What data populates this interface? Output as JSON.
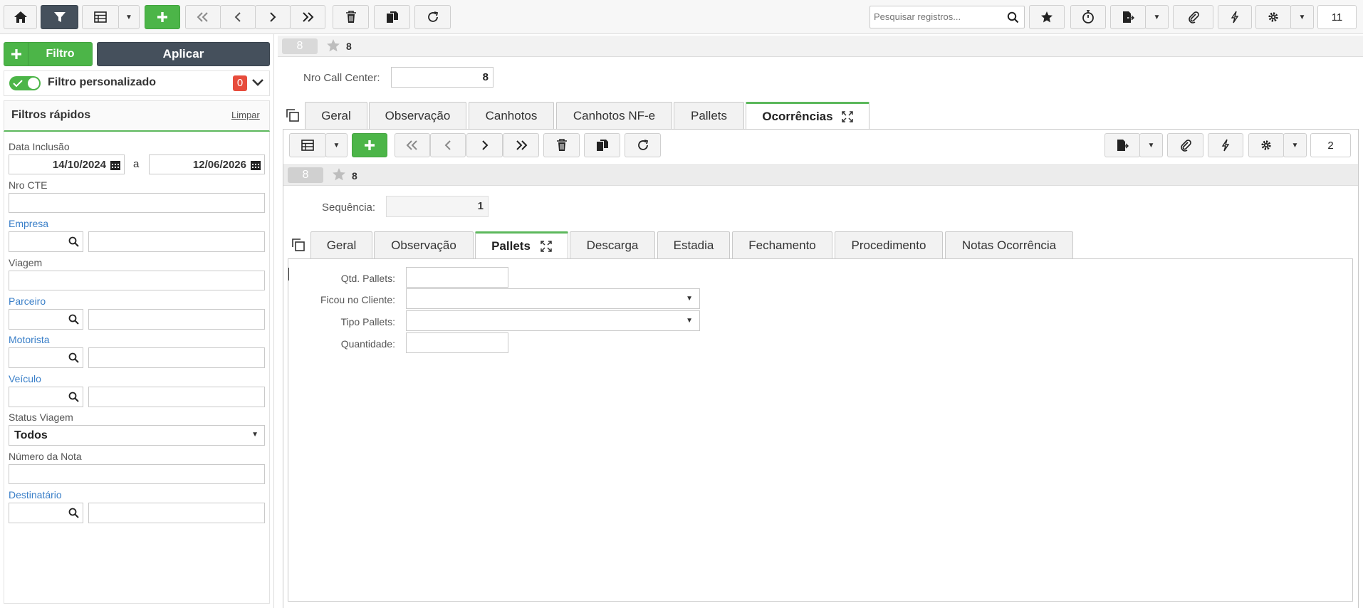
{
  "toolbar": {
    "search_placeholder": "Pesquisar registros...",
    "counter": "11"
  },
  "filter_panel": {
    "add_filter_label": "Filtro",
    "apply_label": "Aplicar",
    "custom_filter_label": "Filtro personalizado",
    "custom_filter_count": "0",
    "quick_filters_title": "Filtros rápidos",
    "clear_label": "Limpar",
    "fields": {
      "data_inclusao_label": "Data Inclusão",
      "date_from": "14/10/2024",
      "date_sep": "a",
      "date_to": "12/06/2026",
      "nro_cte_label": "Nro CTE",
      "empresa_label": "Empresa",
      "viagem_label": "Viagem",
      "parceiro_label": "Parceiro",
      "motorista_label": "Motorista",
      "veiculo_label": "Veículo",
      "status_viagem_label": "Status Viagem",
      "status_viagem_value": "Todos",
      "numero_nota_label": "Número da Nota",
      "destinatario_label": "Destinatário"
    }
  },
  "record": {
    "badge": "8",
    "fav_id": "8",
    "nro_call_center_label": "Nro Call Center:",
    "nro_call_center_value": "8"
  },
  "main_tabs": [
    "Geral",
    "Observação",
    "Canhotos",
    "Canhotos NF-e",
    "Pallets",
    "Ocorrências"
  ],
  "sub_toolbar": {
    "counter": "2"
  },
  "sub_record": {
    "badge": "8",
    "fav_id": "8",
    "sequencia_label": "Sequência:",
    "sequencia_value": "1"
  },
  "sub_tabs": [
    "Geral",
    "Observação",
    "Pallets",
    "Descarga",
    "Estadia",
    "Fechamento",
    "Procedimento",
    "Notas Ocorrência"
  ],
  "pallets_form": {
    "qtd_pallets_label": "Qtd. Pallets:",
    "ficou_cliente_label": "Ficou no Cliente:",
    "tipo_pallets_label": "Tipo Pallets:",
    "quantidade_label": "Quantidade:"
  },
  "colors": {
    "green": "#4cb548",
    "dark": "#45505c",
    "link": "#3a7fc8",
    "badge_red": "#e74c3c"
  }
}
